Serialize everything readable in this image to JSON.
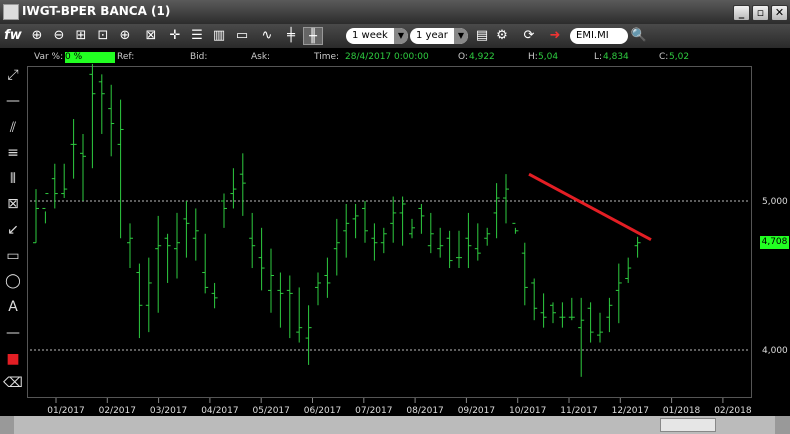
{
  "window": {
    "title": "IWGT-BPER BANCA (1)"
  },
  "toolbar": {
    "fx_label": "fw",
    "interval": "1 week",
    "range": "1 year",
    "symbol": "EMI.MI",
    "icons": [
      "zoom-in-icon",
      "zoom-out-icon",
      "zoom-fit-icon",
      "zoom-reset-icon",
      "zoom-area-icon",
      "crosshair-icon",
      "list-icon",
      "columns-icon",
      "window-icon",
      "line-chart-icon",
      "candle-icon",
      "ohlc-bar-icon",
      "table-icon",
      "refresh-icon",
      "export-icon",
      "search-icon"
    ]
  },
  "infobar": {
    "var_label": "Var %:",
    "var_value": "0 %",
    "ref_label": "Ref:",
    "bid_label": "Bid:",
    "ask_label": "Ask:",
    "time_label": "Time:",
    "time_value": "28/4/2017 0:00:00",
    "open_label": "O:",
    "open_value": "4,922",
    "high_label": "H:",
    "high_value": "5,04",
    "low_label": "L:",
    "low_value": "4,834",
    "close_label": "C:",
    "close_value": "5,02"
  },
  "chart_data": {
    "type": "ohlc",
    "series_color": "#2ecc40",
    "y_ticks": [
      "5,000",
      "4,000"
    ],
    "y_tick_values": [
      5.0,
      4.0
    ],
    "last_price_label": "4,708",
    "last_price": 4.708,
    "x_ticks": [
      "01/2017",
      "02/2017",
      "03/2017",
      "04/2017",
      "05/2017",
      "06/2017",
      "07/2017",
      "08/2017",
      "09/2017",
      "10/2017",
      "11/2017",
      "12/2017",
      "01/2018",
      "02/2018"
    ],
    "grid": "horizontal-dotted",
    "trendline": {
      "color": "#e31e24",
      "from": {
        "date": "10/2017",
        "price": 5.18
      },
      "to": {
        "date": "12/2017",
        "price": 4.74
      }
    },
    "bars": [
      [
        4.72,
        5.08,
        4.72,
        4.95
      ],
      [
        4.95,
        4.93,
        4.85,
        5.05
      ],
      [
        5.15,
        5.25,
        4.95,
        5.05
      ],
      [
        5.05,
        5.25,
        5.02,
        5.08
      ],
      [
        5.38,
        5.55,
        5.15,
        5.38
      ],
      [
        5.32,
        5.45,
        5.0,
        5.3
      ],
      [
        5.85,
        5.92,
        5.22,
        5.72
      ],
      [
        5.8,
        5.85,
        5.45,
        5.72
      ],
      [
        5.62,
        5.78,
        5.3,
        5.52
      ],
      [
        5.38,
        5.68,
        4.75,
        5.48
      ],
      [
        4.72,
        4.85,
        4.55,
        4.75
      ],
      [
        4.52,
        4.58,
        4.08,
        4.3
      ],
      [
        4.3,
        4.62,
        4.12,
        4.45
      ],
      [
        4.68,
        4.9,
        4.25,
        4.7
      ],
      [
        4.75,
        4.78,
        4.45,
        4.7
      ],
      [
        4.68,
        4.92,
        4.48,
        4.72
      ],
      [
        4.88,
        5.0,
        4.62,
        4.85
      ],
      [
        4.75,
        4.95,
        4.6,
        4.8
      ],
      [
        4.52,
        4.78,
        4.38,
        4.42
      ],
      [
        4.38,
        4.45,
        4.28,
        4.35
      ],
      [
        5.0,
        5.05,
        4.82,
        4.95
      ],
      [
        5.05,
        5.22,
        4.95,
        5.08
      ],
      [
        5.18,
        5.32,
        4.9,
        5.12
      ],
      [
        4.75,
        4.92,
        4.55,
        4.7
      ],
      [
        4.62,
        4.82,
        4.4,
        4.55
      ],
      [
        4.4,
        4.68,
        4.25,
        4.5
      ],
      [
        4.4,
        4.52,
        4.15,
        4.38
      ],
      [
        4.4,
        4.5,
        4.08,
        4.38
      ],
      [
        4.12,
        4.42,
        4.05,
        4.15
      ],
      [
        4.08,
        4.3,
        3.9,
        4.15
      ],
      [
        4.42,
        4.52,
        4.3,
        4.45
      ],
      [
        4.5,
        4.62,
        4.35,
        4.45
      ],
      [
        4.68,
        4.88,
        4.5,
        4.72
      ],
      [
        4.8,
        4.98,
        4.62,
        4.85
      ],
      [
        4.88,
        4.98,
        4.75,
        4.9
      ],
      [
        4.95,
        5.0,
        4.72,
        4.8
      ],
      [
        4.75,
        4.85,
        4.6,
        4.72
      ],
      [
        4.72,
        4.82,
        4.65,
        4.78
      ],
      [
        4.85,
        5.03,
        4.72,
        4.92
      ],
      [
        4.92,
        5.03,
        4.7,
        4.98
      ],
      [
        4.78,
        4.88,
        4.75,
        4.82
      ],
      [
        4.95,
        4.98,
        4.78,
        4.9
      ],
      [
        4.7,
        4.92,
        4.65,
        4.78
      ],
      [
        4.68,
        4.82,
        4.62,
        4.7
      ],
      [
        4.75,
        4.8,
        4.55,
        4.6
      ],
      [
        4.62,
        4.8,
        4.55,
        4.62
      ],
      [
        4.75,
        4.92,
        4.55,
        4.7
      ],
      [
        4.68,
        4.85,
        4.6,
        4.65
      ],
      [
        4.75,
        4.82,
        4.7,
        4.78
      ],
      [
        4.92,
        5.12,
        4.75,
        5.02
      ],
      [
        5.02,
        5.18,
        4.85,
        5.08
      ],
      [
        4.85,
        4.82,
        4.78,
        4.8
      ],
      [
        4.65,
        4.72,
        4.3,
        4.42
      ],
      [
        4.45,
        4.48,
        4.2,
        4.28
      ],
      [
        4.25,
        4.38,
        4.15,
        4.22
      ],
      [
        4.3,
        4.32,
        4.18,
        4.25
      ],
      [
        4.22,
        4.32,
        4.15,
        4.22
      ],
      [
        4.22,
        4.35,
        4.2,
        4.22
      ],
      [
        4.15,
        4.35,
        3.82,
        4.2
      ],
      [
        4.28,
        4.32,
        4.05,
        4.12
      ],
      [
        4.1,
        4.25,
        4.05,
        4.12
      ],
      [
        4.22,
        4.35,
        4.12,
        4.3
      ],
      [
        4.4,
        4.58,
        4.18,
        4.45
      ],
      [
        4.48,
        4.62,
        4.45,
        4.55
      ],
      [
        4.7,
        4.76,
        4.62,
        4.72
      ]
    ]
  },
  "left_tools": [
    {
      "name": "trendline-tool-icon",
      "glyph": "⤢"
    },
    {
      "name": "horizontal-line-tool-icon",
      "glyph": "—"
    },
    {
      "name": "parallel-lines-tool-icon",
      "glyph": "⫽"
    },
    {
      "name": "fibonacci-tool-icon",
      "glyph": "≡"
    },
    {
      "name": "vertical-lines-tool-icon",
      "glyph": "⦀"
    },
    {
      "name": "gann-tool-icon",
      "glyph": "⊠"
    },
    {
      "name": "arrow-tool-icon",
      "glyph": "↙"
    },
    {
      "name": "rectangle-tool-icon",
      "glyph": "▭"
    },
    {
      "name": "ellipse-tool-icon",
      "glyph": "◯"
    },
    {
      "name": "text-tool-icon",
      "glyph": "A"
    },
    {
      "name": "line-width-tool-icon",
      "glyph": "—"
    },
    {
      "name": "color-picker-tool-icon",
      "glyph": "■"
    },
    {
      "name": "eraser-tool-icon",
      "glyph": "⌫"
    }
  ]
}
